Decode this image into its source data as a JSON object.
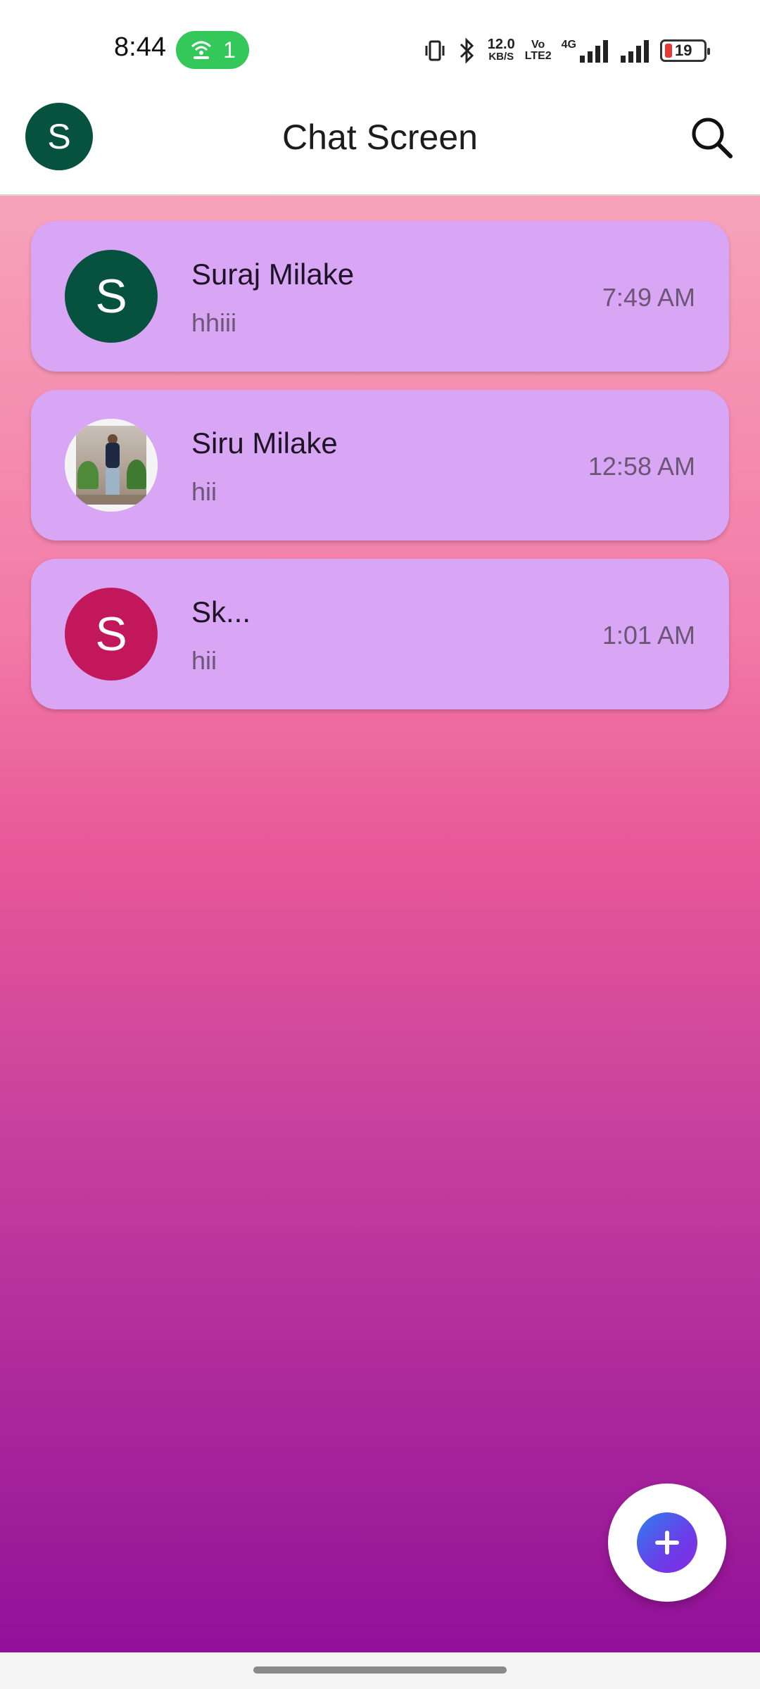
{
  "status_bar": {
    "time": "8:44",
    "hotspot_count": "1",
    "network_speed_value": "12.0",
    "network_speed_unit": "KB/S",
    "volte_top": "Vo",
    "volte_bottom": "LTE2",
    "network_type": "4G",
    "battery_level": "19"
  },
  "app_bar": {
    "avatar_initial": "S",
    "title": "Chat Screen"
  },
  "chats": [
    {
      "name": "Suraj Milake",
      "last_message": "hhiii",
      "time": "7:49 AM",
      "avatar_initial": "S",
      "avatar_color": "#07513f"
    },
    {
      "name": "Siru Milake",
      "last_message": "hii",
      "time": "12:58 AM",
      "avatar_type": "photo"
    },
    {
      "name": "Sk...",
      "last_message": "hii",
      "time": "1:01 AM",
      "avatar_initial": "S",
      "avatar_color": "#c2185b"
    }
  ],
  "colors": {
    "card_background": "#d9a5f5",
    "gradient_top": "#f7a3bb",
    "gradient_bottom": "#92109a",
    "fab_gradient_start": "#2f80ed",
    "fab_gradient_end": "#8a2be2"
  },
  "icons": {
    "search": "search-icon",
    "fab": "plus-icon",
    "hotspot": "hotspot-icon",
    "vibrate": "vibrate-icon",
    "bluetooth": "bluetooth-icon",
    "signal": "signal-icon"
  }
}
